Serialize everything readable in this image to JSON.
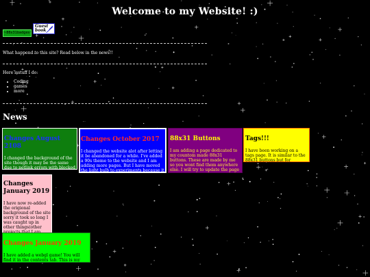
{
  "header": {
    "title": "Welcome to my Website! :)"
  },
  "buttons": {
    "badge_88x31_text": "~88x31badges~",
    "guestbook_label": "Guest book"
  },
  "intro": {
    "text": "What happend to this site? Read below in the news!!"
  },
  "stuff": {
    "heading": "Here isstuff I do:",
    "items": [
      "Coding",
      "games",
      "more"
    ]
  },
  "news": {
    "heading": "News",
    "cards": [
      {
        "title": "Changes August 2108",
        "body": "I changed the background of the site though it may be the same due to netlink errors with blocked sites i changed the image of now if you are"
      },
      {
        "title": "Changes October 2017",
        "body": "I changed the website alot after letting it be abandoned for a while. I've added a 90s theme to the website and I am adding more pages. But I have moved the light bulb to experiments because it doesnt go nice with the"
      },
      {
        "title": "88x31 Buttons",
        "body": "I am adding a page dedicated to my countom made 88x31 buttons. These are made by me so you wont find them anywhere else. I will try to update the page as much as possible."
      },
      {
        "title": "Tags!!!",
        "body": "I have been working on a tags page. It is similar to the 88x31 buttons but for "
      },
      {
        "title": "Changes January 2019",
        "body": "I have now re-added the origional background of the site sorry it took so long I was caught up in other things(other projects that I am working on). I"
      },
      {
        "title": "Changes January 2019",
        "body": "I have added a webgl game! You will find it in the contents tab. This is my first unity made"
      }
    ]
  },
  "colors": {
    "background": "#000000",
    "card_green": "#0e7e0e",
    "card_blue": "#0000ff",
    "card_purple": "#800080",
    "card_yellow": "#ffff00",
    "card_pink": "#ffc0cb",
    "card_lime": "#00ff00"
  }
}
